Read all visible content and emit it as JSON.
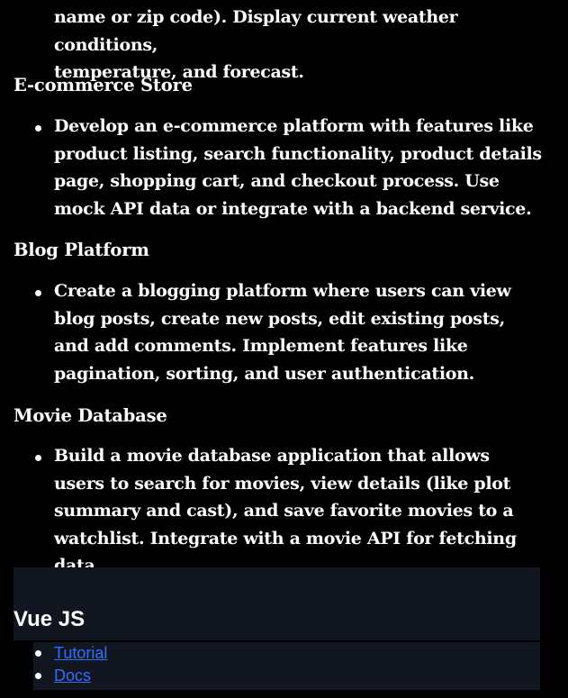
{
  "weather": {
    "continuation_line1": "name or zip code). Display current weather conditions,",
    "continuation_line2": "temperature, and forecast."
  },
  "sections": [
    {
      "title": "E-commerce Store",
      "bullet": "Develop an e-commerce platform with features like product listing, search functionality, product details page, shopping cart, and checkout process. Use mock API data or integrate with a backend service."
    },
    {
      "title": "Blog Platform",
      "bullet": "Create a blogging platform where users can view blog posts, create new posts, edit existing posts, and add comments. Implement features like pagination, sorting, and user authentication."
    },
    {
      "title": "Movie Database",
      "bullet": "Build a movie database application that allows users to search for movies, view details (like plot summary and cast), and save favorite movies to a watchlist. Integrate with a movie API for fetching data."
    }
  ],
  "vue": {
    "title": "Vue JS",
    "links": [
      {
        "label": "Tutorial"
      },
      {
        "label": "Docs"
      }
    ]
  },
  "colors": {
    "background": "#000000",
    "text": "#ffffff",
    "panel": "#121621",
    "link": "#2f6fff"
  }
}
